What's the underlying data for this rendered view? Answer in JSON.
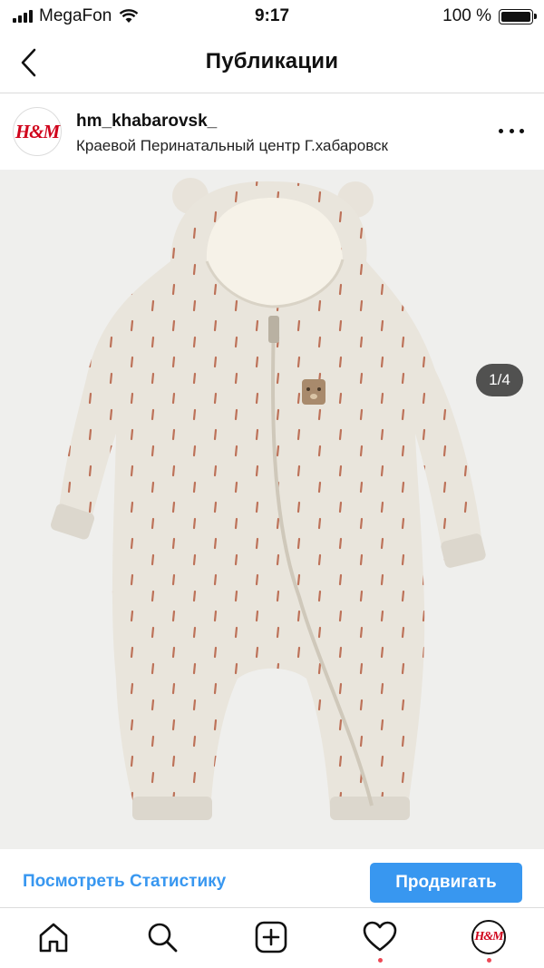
{
  "status_bar": {
    "carrier": "MegaFon",
    "time": "9:17",
    "battery": "100 %",
    "battery_level": 1.0
  },
  "nav": {
    "title": "Публикации",
    "back_icon": "chevron-left-icon"
  },
  "post": {
    "username": "hm_khabarovsk_",
    "location": "Краевой Перинатальный центр Г.хабаровск",
    "avatar_logo": "H&M",
    "more_icon": "more-horizontal-icon",
    "image_counter": "1/4",
    "image_subject": "baby-onesie-photo"
  },
  "actions": {
    "stats_link": "Посмотреть Статистику",
    "promote_button": "Продвигать"
  },
  "tab_bar": {
    "items": [
      {
        "icon": "home-icon"
      },
      {
        "icon": "search-icon"
      },
      {
        "icon": "add-post-icon"
      },
      {
        "icon": "heart-icon"
      },
      {
        "icon": "profile-avatar-icon",
        "logo": "H&M"
      }
    ]
  },
  "colors": {
    "accent": "#3897f0",
    "notification_dot": "#ed4956",
    "brand_red": "#d0021b",
    "photo_background": "#efefed"
  }
}
